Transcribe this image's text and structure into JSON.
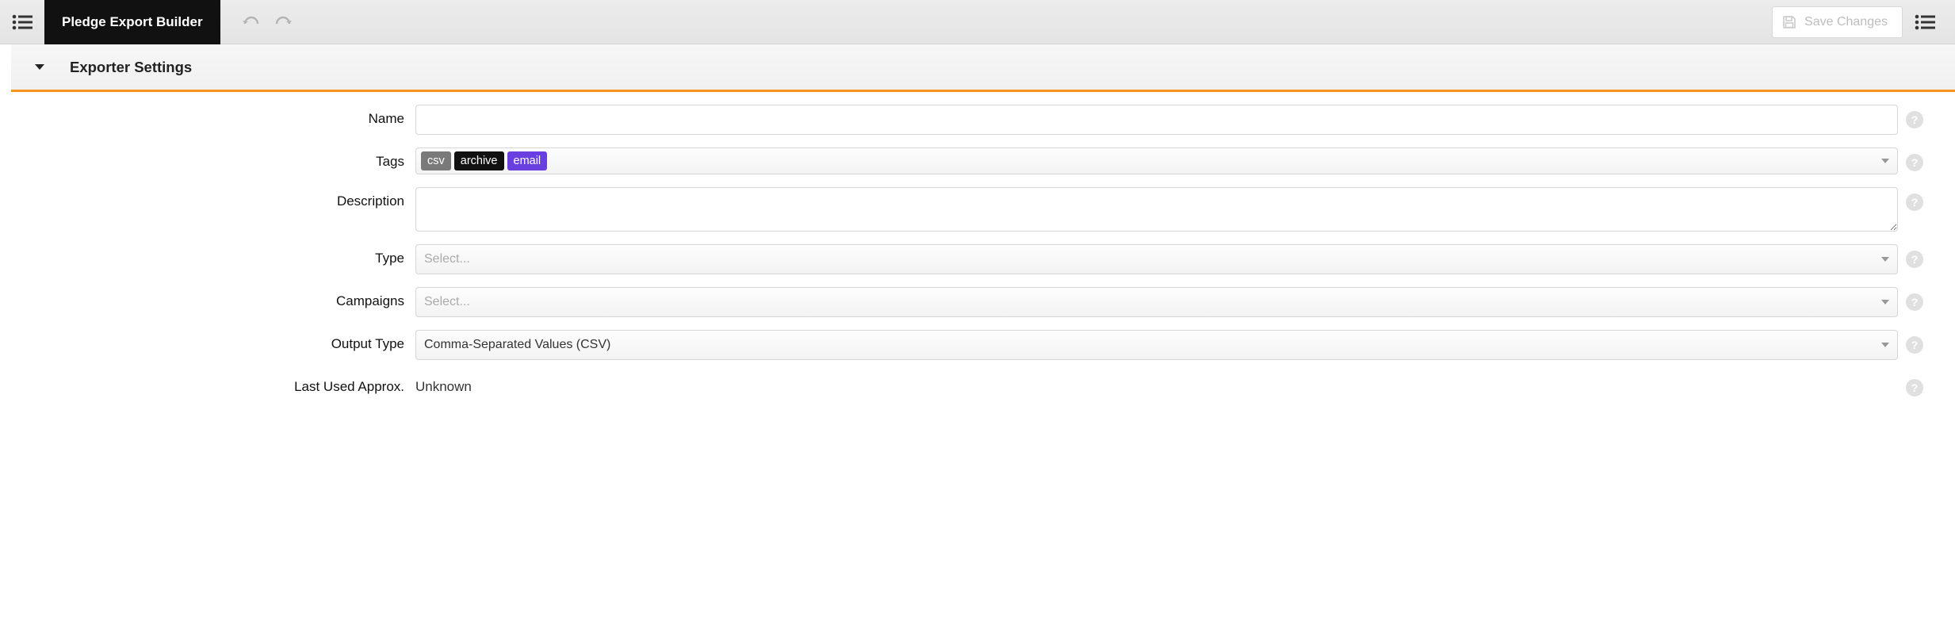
{
  "toolbar": {
    "title": "Pledge Export Builder",
    "save_label": "Save Changes"
  },
  "section": {
    "title": "Exporter Settings"
  },
  "fields": {
    "name": {
      "label": "Name",
      "value": ""
    },
    "tags": {
      "label": "Tags",
      "items": [
        {
          "text": "csv",
          "bg": "#7a7a7a"
        },
        {
          "text": "archive",
          "bg": "#111111"
        },
        {
          "text": "email",
          "bg": "#6a3fe0"
        }
      ]
    },
    "description": {
      "label": "Description",
      "value": ""
    },
    "type": {
      "label": "Type",
      "placeholder": "Select..."
    },
    "campaigns": {
      "label": "Campaigns",
      "placeholder": "Select..."
    },
    "output_type": {
      "label": "Output Type",
      "value": "Comma-Separated Values (CSV)"
    },
    "last_used": {
      "label": "Last Used Approx.",
      "value": "Unknown"
    }
  },
  "help_glyph": "?"
}
